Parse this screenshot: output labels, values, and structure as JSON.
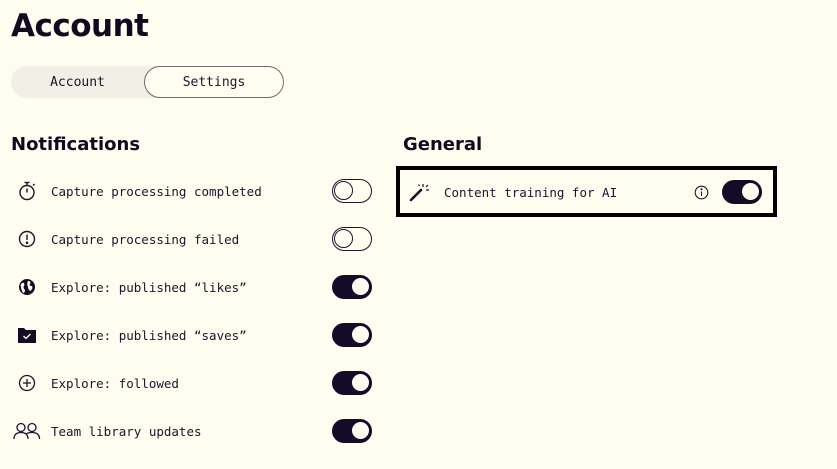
{
  "page": {
    "title": "Account"
  },
  "tabs": [
    {
      "label": "Account",
      "selected": false
    },
    {
      "label": "Settings",
      "selected": true
    }
  ],
  "notifications": {
    "heading": "Notifications",
    "items": [
      {
        "label": "Capture processing completed",
        "icon": "stopwatch-icon",
        "enabled": false
      },
      {
        "label": "Capture processing failed",
        "icon": "alert-circle-icon",
        "enabled": false
      },
      {
        "label": "Explore: published “likes”",
        "icon": "globe-icon",
        "enabled": true
      },
      {
        "label": "Explore: published “saves”",
        "icon": "folder-check-icon",
        "enabled": true
      },
      {
        "label": "Explore: followed",
        "icon": "plus-circle-icon",
        "enabled": true
      },
      {
        "label": "Team library updates",
        "icon": "users-icon",
        "enabled": true
      }
    ]
  },
  "general": {
    "heading": "General",
    "items": [
      {
        "label": "Content training for AI",
        "icon": "magic-wand-icon",
        "info_icon": "info-icon",
        "enabled": true
      }
    ]
  },
  "colors": {
    "background": "#fefdf0",
    "toggle_on": "#120c26",
    "text": "#1a1530"
  }
}
